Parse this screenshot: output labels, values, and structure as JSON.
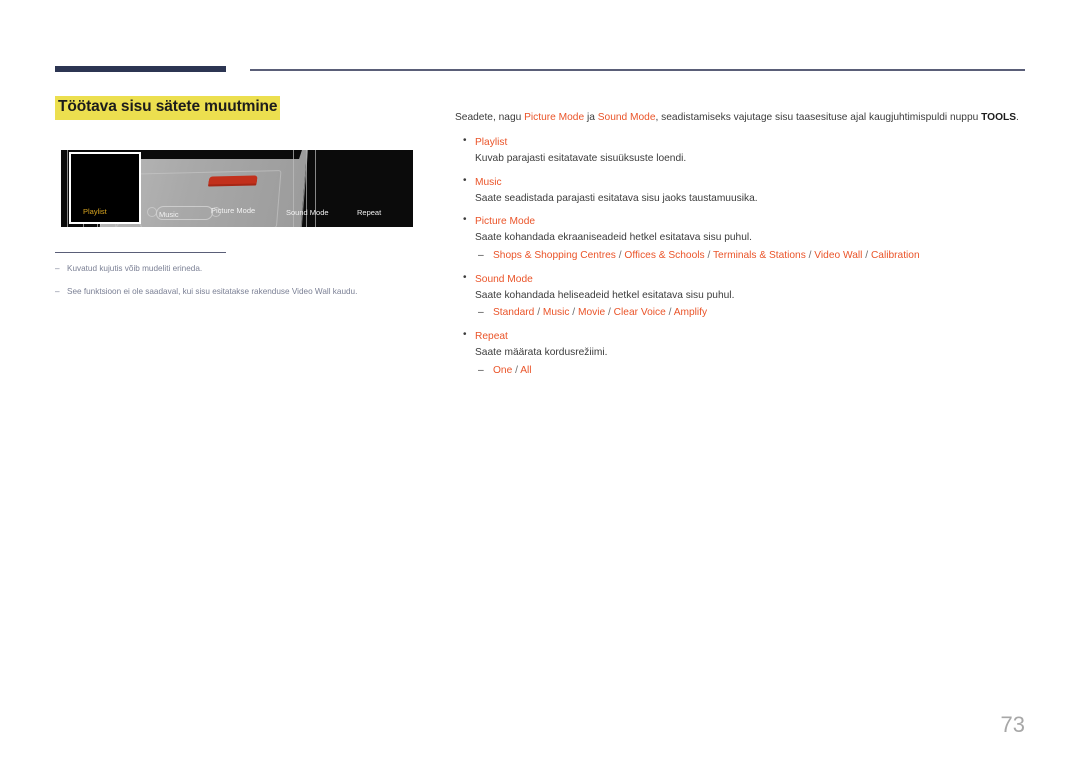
{
  "page": {
    "number": "73"
  },
  "section": {
    "title": "Töötava sisu sätete muutmine"
  },
  "figure": {
    "labels": [
      {
        "name": "Playlist",
        "highlighted": true
      },
      {
        "name": "Music",
        "highlighted": false
      },
      {
        "name": "Picture Mode",
        "highlighted": false
      },
      {
        "name": "Sound Mode",
        "highlighted": false
      },
      {
        "name": "Repeat",
        "highlighted": false
      }
    ],
    "highlight_color": "#d9a520",
    "background_color": "#0b0b0b"
  },
  "notes": [
    "Kuvatud kujutis võib mudeliti erineda.",
    "See funktsioon ei ole saadaval, kui sisu esitatakse rakenduse Video Wall kaudu."
  ],
  "intro": {
    "part1": "Seadete, nagu ",
    "accent1": "Picture Mode",
    "part2": " ja ",
    "accent2": "Sound Mode",
    "part3": ", seadistamiseks vajutage sisu taasesituse ajal kaugjuhtimispuldi nuppu ",
    "bold1": "TOOLS",
    "part4": "."
  },
  "bullets": [
    {
      "title": "Playlist",
      "desc": "Kuvab parajasti esitatavate sisuüksuste loendi.",
      "options": []
    },
    {
      "title": "Music",
      "desc": "Saate seadistada parajasti esitatava sisu jaoks taustamuusika.",
      "options": []
    },
    {
      "title": "Picture Mode",
      "desc": "Saate kohandada ekraaniseadeid hetkel esitatava sisu puhul.",
      "options": [
        "Shops & Shopping Centres",
        "Offices & Schools",
        "Terminals & Stations",
        "Video Wall",
        "Calibration"
      ]
    },
    {
      "title": "Sound Mode",
      "desc": "Saate kohandada heliseadeid hetkel esitatava sisu puhul.",
      "options": [
        "Standard",
        "Music",
        "Movie",
        "Clear Voice",
        "Amplify"
      ]
    },
    {
      "title": "Repeat",
      "desc": "Saate määrata kordusrežiimi.",
      "options": [
        "One",
        "All"
      ]
    }
  ],
  "colors": {
    "accent": "#ea5429",
    "highlight": "#ecdf4f",
    "rule": "#2c3552",
    "note_text": "#7b8095",
    "page_number": "#a7a7a7"
  }
}
